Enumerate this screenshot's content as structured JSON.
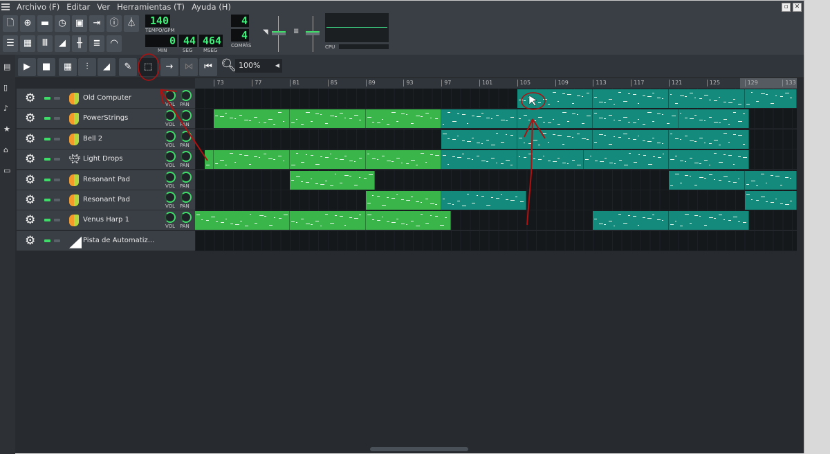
{
  "menu": [
    "Archivo (F)",
    "Editar",
    "Ver",
    "Herramientas (T)",
    "Ayuda (H)"
  ],
  "tempo": {
    "value": "140",
    "label": "TEMPO/GPM"
  },
  "time": {
    "min": "0",
    "min_label": "MIN",
    "sec": "44",
    "sec_label": "SEG",
    "msec": "464",
    "msec_label": "MSEG"
  },
  "timesig": {
    "num": "4",
    "den": "4",
    "label": "COMPÁS"
  },
  "cpu_label": "CPU",
  "zoom": "100%",
  "ruler": [
    "73",
    "77",
    "81",
    "85",
    "89",
    "93",
    "97",
    "101",
    "105",
    "109",
    "113",
    "117",
    "121",
    "125",
    "129",
    "133"
  ],
  "tracks": [
    {
      "name": "Old Computer",
      "icon": "triple-oscillator",
      "vol": "VOL",
      "pan": "PAN",
      "patterns": [
        [
          105,
          113,
          "t"
        ],
        [
          113,
          121,
          "t"
        ],
        [
          121,
          129,
          "t"
        ],
        [
          129,
          134.5,
          "t"
        ]
      ]
    },
    {
      "name": "PowerStrings",
      "icon": "triple-oscillator",
      "vol": "VOL",
      "pan": "PAN",
      "patterns": [
        [
          73,
          81,
          "g"
        ],
        [
          81,
          89,
          "g"
        ],
        [
          89,
          97,
          "g"
        ],
        [
          97,
          105,
          "t"
        ],
        [
          105,
          113,
          "t"
        ],
        [
          113,
          122,
          "t"
        ],
        [
          122,
          129.5,
          "t"
        ]
      ]
    },
    {
      "name": "Bell 2",
      "icon": "triple-oscillator",
      "vol": "VOL",
      "pan": "PAN",
      "patterns": [
        [
          97,
          105,
          "t"
        ],
        [
          105,
          113,
          "t"
        ],
        [
          113,
          121,
          "t"
        ],
        [
          121,
          129.5,
          "t"
        ]
      ]
    },
    {
      "name": "Light Drops",
      "icon": "bitinvader",
      "vol": "VOL",
      "pan": "PAN",
      "patterns": [
        [
          72,
          73,
          "g"
        ],
        [
          73,
          81,
          "g"
        ],
        [
          81,
          89,
          "g"
        ],
        [
          89,
          97,
          "g"
        ],
        [
          97,
          105,
          "t"
        ],
        [
          105,
          112,
          "t"
        ],
        [
          112,
          121,
          "t"
        ],
        [
          121,
          129.5,
          "t"
        ]
      ]
    },
    {
      "name": "Resonant Pad",
      "icon": "triple-oscillator",
      "vol": "VOL",
      "pan": "PAN",
      "patterns": [
        [
          81,
          90,
          "g"
        ],
        [
          121,
          129,
          "t"
        ],
        [
          129,
          134.5,
          "t"
        ]
      ]
    },
    {
      "name": "Resonant Pad",
      "icon": "triple-oscillator",
      "vol": "VOL",
      "pan": "PAN",
      "patterns": [
        [
          89,
          97,
          "g"
        ],
        [
          97,
          106,
          "t"
        ],
        [
          129,
          134.5,
          "t"
        ]
      ]
    },
    {
      "name": "Venus Harp 1",
      "icon": "triple-oscillator",
      "vol": "VOL",
      "pan": "PAN",
      "patterns": [
        [
          71,
          81,
          "g"
        ],
        [
          81,
          89,
          "g"
        ],
        [
          89,
          98,
          "g"
        ],
        [
          113,
          121,
          "t"
        ],
        [
          121,
          129.5,
          "t"
        ]
      ]
    },
    {
      "name": "Pista de Automatiz...",
      "icon": "automation",
      "patterns": []
    }
  ],
  "colors": {
    "green": "#39b54a",
    "teal": "#138a7c",
    "annotation": "#b01010"
  }
}
